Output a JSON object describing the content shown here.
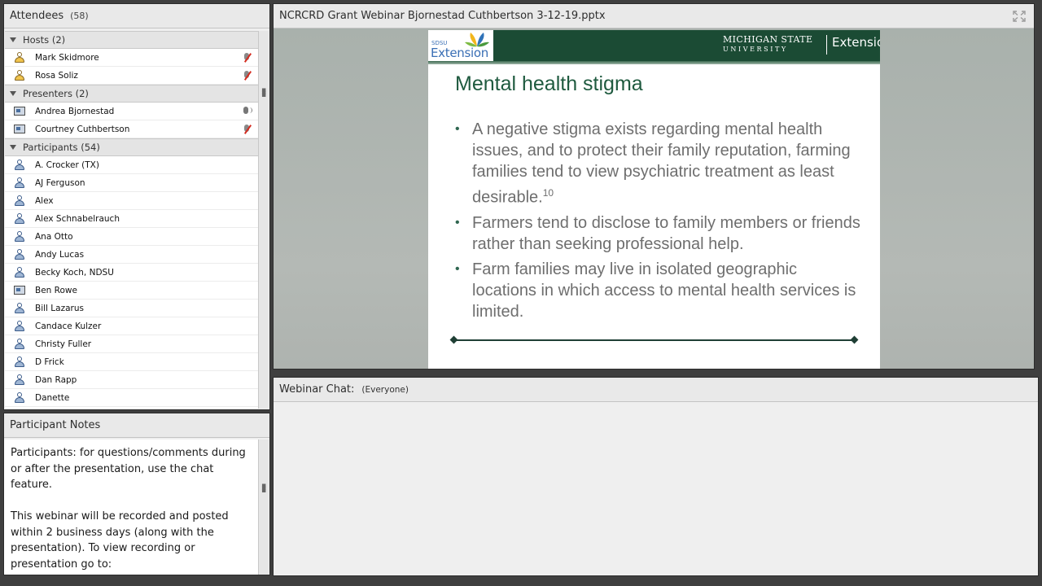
{
  "attendees": {
    "title": "Attendees",
    "count": "(58)",
    "sections": {
      "hosts": {
        "label": "Hosts (2)",
        "rows": [
          {
            "name": "Mark Skidmore"
          },
          {
            "name": "Rosa Soliz"
          }
        ]
      },
      "presenters": {
        "label": "Presenters (2)",
        "rows": [
          {
            "name": "Andrea Bjornestad"
          },
          {
            "name": "Courtney Cuthbertson"
          }
        ]
      },
      "participants": {
        "label": "Participants (54)",
        "rows": [
          {
            "name": "A. Crocker (TX)"
          },
          {
            "name": "AJ Ferguson"
          },
          {
            "name": "Alex"
          },
          {
            "name": "Alex Schnabelrauch"
          },
          {
            "name": "Ana Otto"
          },
          {
            "name": "Andy Lucas"
          },
          {
            "name": "Becky Koch, NDSU"
          },
          {
            "name": "Ben Rowe"
          },
          {
            "name": "Bill Lazarus"
          },
          {
            "name": "Candace Kulzer"
          },
          {
            "name": "Christy Fuller"
          },
          {
            "name": "D Frick"
          },
          {
            "name": "Dan Rapp"
          },
          {
            "name": "Danette"
          }
        ]
      }
    }
  },
  "notes": {
    "title": "Participant Notes",
    "paragraph1": "Participants: for questions/comments during or after the presentation, use the chat feature.",
    "paragraph2": "This webinar will be recorded and posted within 2 business days (along with the presentation). To view recording or presentation go to:"
  },
  "share": {
    "title": "NCRCRD Grant Webinar Bjornestad Cuthbertson 3-12-19.pptx",
    "slide": {
      "sdsu_small": "SDSU",
      "sdsu_extension": "Extension",
      "msu_line1": "MICHIGAN STATE",
      "msu_line2": "UNIVERSITY",
      "msu_extension": "Extension",
      "title": "Mental health stigma",
      "bullet1": "A negative stigma exists regarding mental health issues, and to protect their family reputation, farming families tend to view psychiatric treatment as least desirable.",
      "bullet1_sup": "10",
      "bullet2": "Farmers tend to disclose to family members or friends rather than seeking professional help.",
      "bullet3": "Farm families may live in isolated geographic locations in which access to mental health services is limited."
    }
  },
  "chat": {
    "title": "Webinar Chat:",
    "scope": "(Everyone)"
  }
}
